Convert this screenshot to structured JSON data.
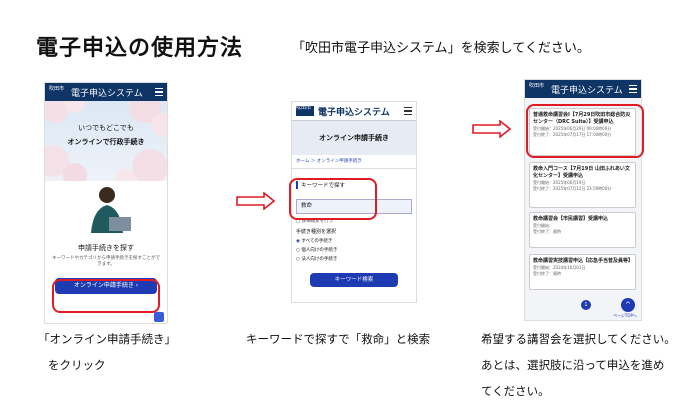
{
  "page": {
    "title": "電子申込の使用方法",
    "search_hint": "「吹田市電子申込システム」を検索してください。"
  },
  "colors": {
    "navy": "#0f3466",
    "button": "#1f3bb3",
    "red": "#e01b24"
  },
  "phone1": {
    "logo": "吹田市",
    "app_title": "電子申込システム",
    "hero_line1": "いつでもどこでも",
    "hero_line2": "オンラインで行政手続き",
    "find_title": "申請手続きを探す",
    "find_desc": "キーワードやカテゴリから申請手続きを探すことができます。",
    "button": "オンライン申請手続き"
  },
  "phone2": {
    "logo": "吹田市",
    "app_title": "電子申込システム",
    "page_title": "オンライン申請手続き",
    "breadcrumb": "ホーム ＞ オンライン申請手続き",
    "keyword_label": "キーワードで探す",
    "keyword_value": "救命",
    "detail_search": "詳細検索を行う",
    "type_label": "手続き種別を選択",
    "types": [
      "すべての手続き",
      "個人向けの手続き",
      "法人向けの手続き"
    ],
    "search_button": "キーワード検索"
  },
  "phone3": {
    "logo": "吹田市",
    "app_title": "電子申込システム",
    "results": [
      {
        "title": "普通救命講習会Ⅰ【7月29日吹田市総合防災センター（DRC Suita）】受講申込",
        "dates": "受付開始：2025年06月29日 09:00時00分",
        "end": "受付終了：2025年07月17日 17:00時00分"
      },
      {
        "title": "救命入門コース【7月19日 山田ふれあい文化センター】受講申込",
        "dates": "受付開始：2025年06月19日",
        "end": "受付終了：2025年07月12日 23:59時00分"
      },
      {
        "title": "救命講習会【市民講習】受講申込",
        "dates": "受付開始：",
        "end": "受付終了：随時"
      },
      {
        "title": "救命講習実技講習申込【応急手当普及員等】",
        "dates": "受付開始：2024年10月01日",
        "end": "受付終了：随時"
      }
    ],
    "page_num": "1",
    "page_top": "ページTOPへ"
  },
  "captions": {
    "c1_line1": "「オンライン申請手続き」",
    "c1_line2": "をクリック",
    "c2": "キーワードで探すで「救命」と検索",
    "c3_line1": "希望する講習会を選択してください。",
    "c3_line2": "あとは、選択肢に沿って申込を進め",
    "c3_line3": "てください。"
  }
}
